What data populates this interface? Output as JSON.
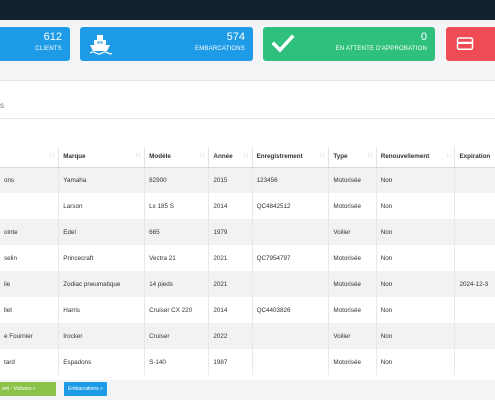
{
  "cards": [
    {
      "number": "612",
      "label": "CLIENTS",
      "icon": "people-icon"
    },
    {
      "number": "574",
      "label": "EMBARCATIONS",
      "icon": "boat-icon"
    },
    {
      "number": "0",
      "label": "EN ATTENTE D'APPROBATION",
      "icon": "checkmark-icon"
    },
    {
      "number": "",
      "label": "",
      "icon": "card-icon"
    }
  ],
  "panel": {
    "title": "s"
  },
  "table": {
    "headers": [
      "",
      "Marque",
      "Modèle",
      "Année",
      "Enregistrement",
      "Type",
      "Renouvellement",
      "Expiration"
    ],
    "rows": [
      [
        "ons",
        "Yamaha",
        "82900",
        "2015",
        "123456",
        "Motorisée",
        "Non",
        ""
      ],
      [
        "",
        "Larson",
        "Lx 185 S",
        "2014",
        "QC4842512",
        "Motorisée",
        "Non",
        ""
      ],
      [
        "ointe",
        "Edel",
        "665",
        "1979",
        "",
        "Voilier",
        "Non",
        ""
      ],
      [
        "selin",
        "Princecraft",
        "Vectra 21",
        "2021",
        "QC7954797",
        "Motorisée",
        "Non",
        ""
      ],
      [
        "ile",
        "Zodiac pneumatique",
        "14 pieds",
        "2021",
        "",
        "Motorisée",
        "Non",
        "2024-12-3"
      ],
      [
        "llet",
        "Harris",
        "Cruiser CX 220",
        "2014",
        "QC4403826",
        "Motorisée",
        "Non",
        ""
      ],
      [
        "e Fournier",
        "Irocker",
        "Cruiser",
        "2022",
        "",
        "Voilier",
        "Non",
        ""
      ],
      [
        "tard",
        "Espadons",
        "S-140",
        "1987",
        "",
        "Motorisée",
        "Non",
        ""
      ]
    ]
  },
  "buttons": {
    "green": "ent - Voitures »",
    "blue": "Embarcations »"
  },
  "colors": {
    "topbar": "#12222f",
    "blue": "#1e9be6",
    "green": "#30c07e",
    "red": "#ef4b55"
  }
}
